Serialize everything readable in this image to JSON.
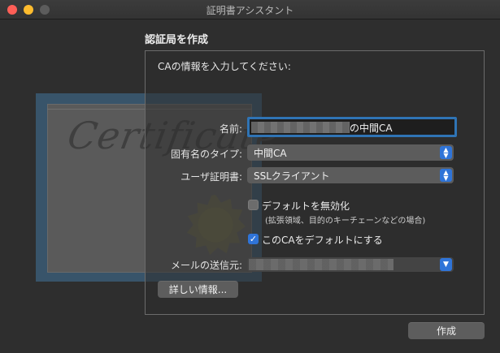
{
  "window": {
    "title": "証明書アシスタント"
  },
  "illustration": {
    "script_text": "Certificate"
  },
  "heading": "認証局を作成",
  "prompt": "CAの情報を入力してください:",
  "form": {
    "name_label": "名前:",
    "name_value_visible": "の中間CA",
    "identity_type_label": "固有名のタイプ:",
    "identity_type_value": "中間CA",
    "user_cert_label": "ユーザ証明書:",
    "user_cert_value": "SSLクライアント",
    "disable_defaults_label": "デフォルトを無効化",
    "disable_defaults_checked": false,
    "disable_defaults_note": "(拡張領域、目的のキーチェーンなどの場合)",
    "make_default_label": "このCAをデフォルトにする",
    "make_default_checked": true,
    "email_label": "メールの送信元:"
  },
  "buttons": {
    "details": "詳しい情報...",
    "create": "作成"
  },
  "colors": {
    "accent": "#2f74d8",
    "focus_ring": "#2f74b5",
    "close": "#ff5f57",
    "minimize": "#febc2e"
  },
  "icons": [
    "chevron-updown-icon",
    "chevron-down-icon",
    "checkmark-icon",
    "certificate-seal-icon"
  ]
}
